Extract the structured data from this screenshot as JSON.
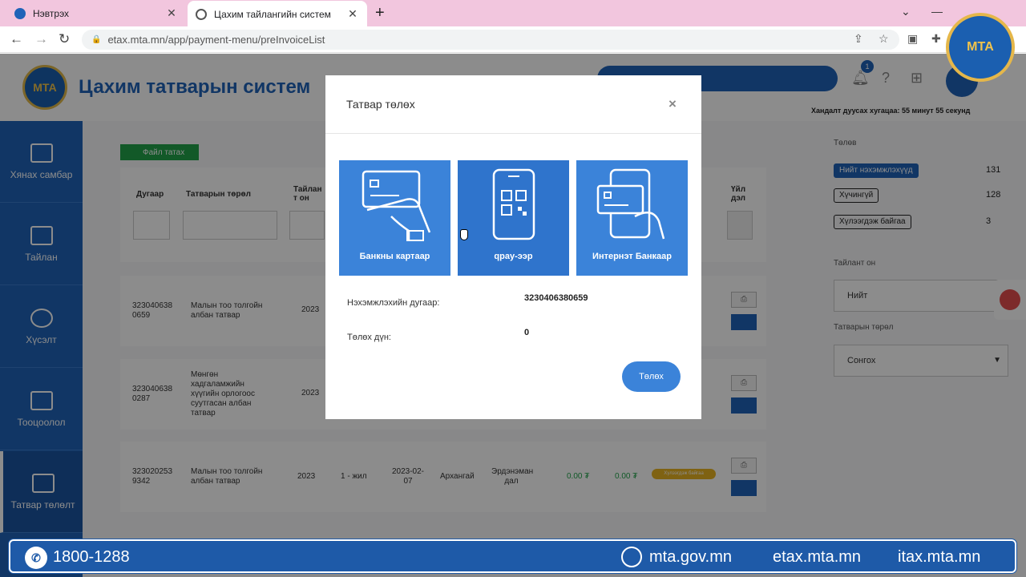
{
  "browser": {
    "tabs": [
      {
        "label": "Нэвтрэх"
      },
      {
        "label": "Цахим тайлангийн систем"
      }
    ],
    "url": "etax.mta.mn/app/payment-menu/preInvoiceList"
  },
  "header": {
    "site_title": "Цахим татварын систем",
    "logo_text": "МТА",
    "notification_count": "1",
    "session_text": "Хандалт дуусах хугацаа: 55 минут 55 секунд"
  },
  "sidebar": {
    "items": [
      {
        "label": "Хянах самбар"
      },
      {
        "label": "Тайлан"
      },
      {
        "label": "Хүсэлт"
      },
      {
        "label": "Тооцоолол"
      },
      {
        "label": "Татвар төлөлт"
      }
    ]
  },
  "main": {
    "download_label": "Файл татах",
    "columns": {
      "number": "Дугаар",
      "tax_type": "Татварын төрөл",
      "report_year": "Тайлан т он",
      "action": "Үйл дэл"
    },
    "rows": [
      {
        "number": "323040638 0659",
        "tax_type": "Малын тоо толгойн албан татвар",
        "year": "2023"
      },
      {
        "number": "323040638 0287",
        "tax_type": "Мөнгөн хадгаламжийн хүүгийн орлогоос суутгасан албан татвар",
        "year": "2023"
      },
      {
        "number": "323020253 9342",
        "tax_type": "Малын тоо толгойн албан татвар",
        "year": "2023",
        "period": "1 - жил",
        "date": "2023-02-07",
        "aimag": "Архангай",
        "soum": "Эрдэнэман дал",
        "amount1": "0.00 ₮",
        "amount2": "0.00 ₮",
        "status": "Хүлээгдэж байгаа"
      }
    ],
    "print_icon": "printer-icon",
    "pay_icon": "card-icon"
  },
  "right_panel": {
    "status_title": "Төлөв",
    "statuses": [
      {
        "label": "Нийт нэхэмжлэхүүд",
        "count": "131"
      },
      {
        "label": "Хүчингүй",
        "count": "128"
      },
      {
        "label": "Хүлээгдэж байгаа",
        "count": "3"
      }
    ],
    "year_title": "Тайлант он",
    "year_value": "Нийт",
    "tax_type_title": "Татварын төрөл",
    "tax_type_value": "Сонгох"
  },
  "modal": {
    "title": "Татвар төлөх",
    "close": "×",
    "options": [
      {
        "label": "Банкны картаар",
        "icon": "bank-card-icon"
      },
      {
        "label": "qpay-ээр",
        "icon": "qr-phone-icon"
      },
      {
        "label": "Интернэт Банкаар",
        "icon": "internet-bank-icon"
      }
    ],
    "invoice_label": "Нэхэмжлэхийн дугаар:",
    "invoice_value": "3230406380659",
    "amount_label": "Төлөх дүн:",
    "amount_value": "0",
    "submit_label": "Төлөх"
  },
  "banner": {
    "phone": "1800-1288",
    "site1": "mta.gov.mn",
    "site2": "etax.mta.mn",
    "site3": "itax.mta.mn"
  },
  "colors": {
    "primary": "#1f63b8",
    "tile": "#3b83d9",
    "green": "#21a34a",
    "badge": "#e8b321"
  }
}
